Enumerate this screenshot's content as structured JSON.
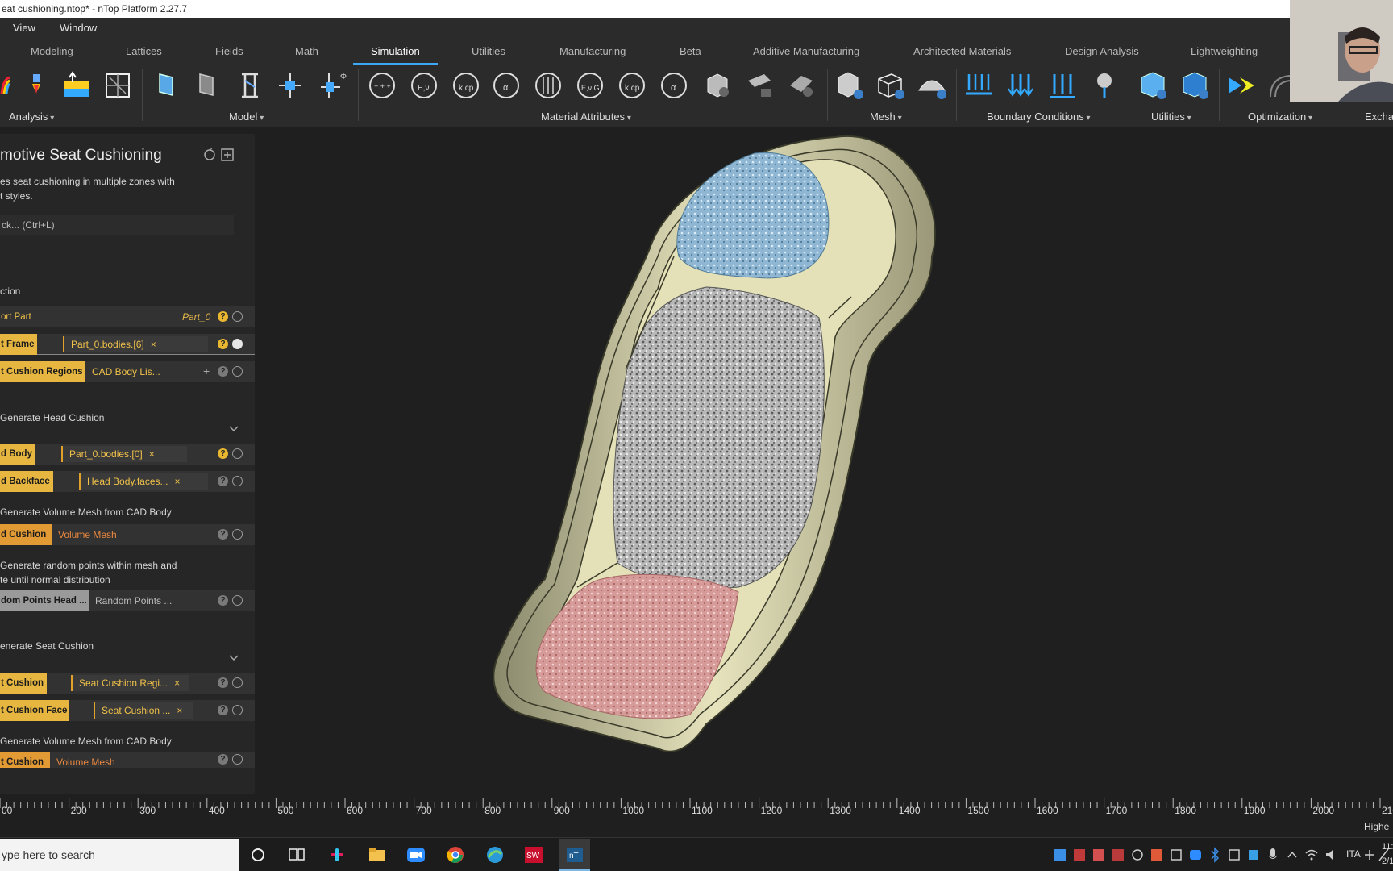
{
  "window": {
    "title": "eat cushioning.ntop* - nTop Platform 2.27.7"
  },
  "menu": [
    "View",
    "Window"
  ],
  "tabs": [
    {
      "label": "Modeling"
    },
    {
      "label": "Lattices"
    },
    {
      "label": "Fields"
    },
    {
      "label": "Math"
    },
    {
      "label": "Simulation"
    },
    {
      "label": "Utilities"
    },
    {
      "label": "Manufacturing"
    },
    {
      "label": "Beta"
    },
    {
      "label": "Additive Manufacturing"
    },
    {
      "label": "Architected Materials"
    },
    {
      "label": "Design Analysis"
    },
    {
      "label": "Lightweighting"
    }
  ],
  "active_tab": "Simulation",
  "ribbon_groups": [
    "Analysis",
    "Model",
    "Material Attributes",
    "Mesh",
    "Boundary Conditions",
    "Utilities",
    "Optimization",
    "Excha"
  ],
  "panel": {
    "title": "motive Seat Cushioning",
    "description_line1": "es seat cushioning in multiple zones with",
    "description_line2": "t styles.",
    "search_placeholder": "ck... (Ctrl+L)",
    "section": "ction",
    "rows": {
      "r1_label": "ort Part",
      "r1_value": "Part_0",
      "r2_label": "t Frame",
      "r2_value": "Part_0.bodies.[6]",
      "r3_label": "t Cushion Regions",
      "r3_value": "CAD Body Lis...",
      "g1": "Generate Head Cushion",
      "r4_label": "d Body",
      "r4_value": "Part_0.bodies.[0]",
      "r5_label": "d Backface",
      "r5_value": "Head Body.faces...",
      "g2": "Generate Volume Mesh from  CAD Body",
      "r6_label": "d Cushion",
      "r6_value": "Volume Mesh",
      "g3_line1": "Generate random points within mesh and",
      "g3_line2": "te until normal distribution",
      "r7_label": "dom Points Head ...",
      "r7_value": "Random Points ...",
      "g4": "enerate Seat Cushion",
      "r8_label": "t Cushion",
      "r8_value": "Seat Cushion Regi...",
      "r9_label": "t Cushion Face",
      "r9_value": "Seat Cushion ...",
      "g5": "Generate Volume Mesh from  CAD Body",
      "r10_label": "t Cushion",
      "r10_value": "Volume Mesh",
      "x_mark": "×",
      "q_mark": "?",
      "plus_mark": "+"
    }
  },
  "ruler": {
    "ticks": [
      "00",
      "200",
      "300",
      "400",
      "500",
      "600",
      "700",
      "800",
      "900",
      "1000",
      "1100",
      "1200",
      "1300",
      "1400",
      "1500",
      "1600",
      "1700",
      "1800",
      "1900",
      "2000",
      "210"
    ]
  },
  "status_right": "Highe",
  "taskbar": {
    "search_placeholder": "ype here to search",
    "lang": "ITA",
    "clock_top": "11:",
    "clock_bottom": "2/1"
  },
  "colors": {
    "accent": "#3da9f5",
    "chip_text": "#f1c24a",
    "head_cushion": "#8fb6d2",
    "seat_cushion": "#d69a98",
    "frame": "#d9d6b0"
  }
}
